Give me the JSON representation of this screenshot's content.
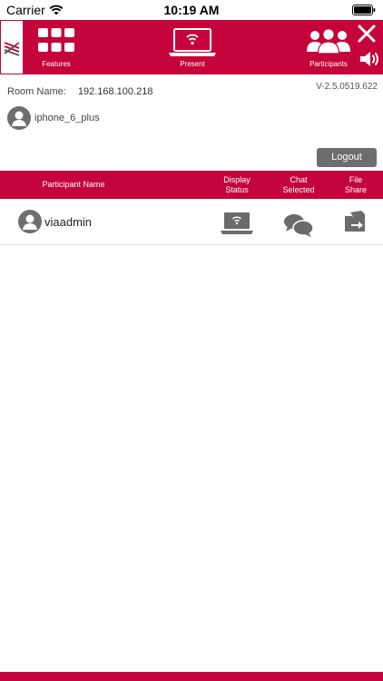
{
  "status_bar": {
    "carrier": "Carrier",
    "time": "10:19 AM"
  },
  "header": {
    "features_label": "Features",
    "present_label": "Present",
    "participants_label": "Participants"
  },
  "room": {
    "label": "Room Name:",
    "value": "192.168.100.218",
    "version": "V-2.5.0519.622"
  },
  "me": {
    "name": "iphone_6_plus"
  },
  "logout_label": "Logout",
  "table": {
    "columns": {
      "name": "Participant Name",
      "display": "Display\nStatus",
      "chat": "Chat\nSelected",
      "file": "File\nShare"
    },
    "rows": [
      {
        "name": "viaadmin"
      }
    ]
  },
  "colors": {
    "brand": "#c4043a",
    "button_gray": "#6d6d6d",
    "icon_gray": "#6b6b6b"
  }
}
